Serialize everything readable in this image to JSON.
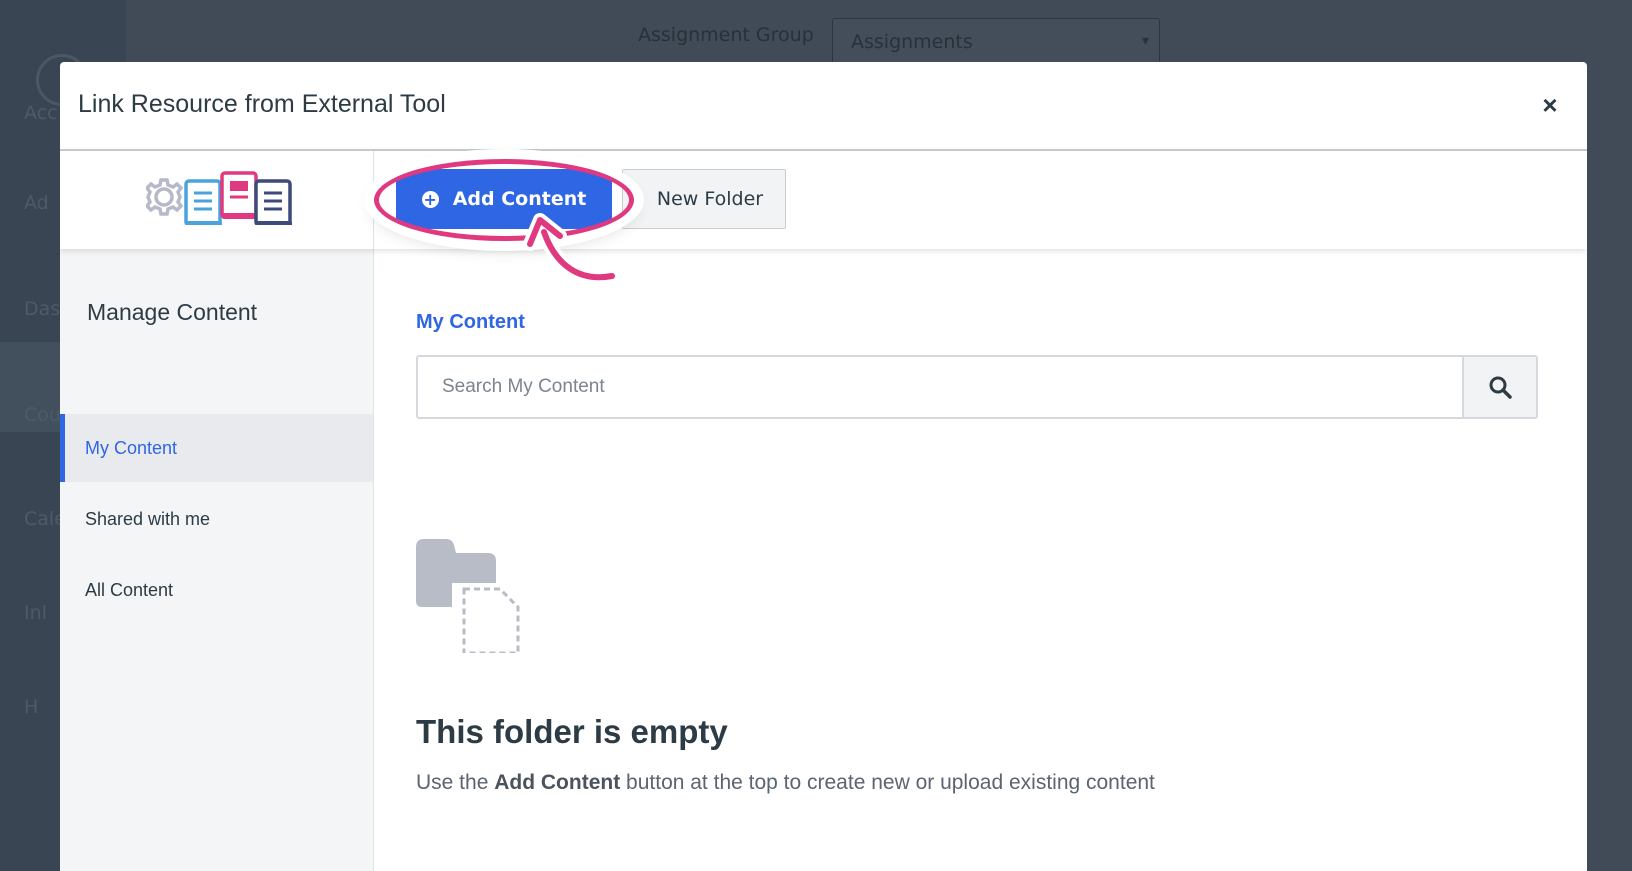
{
  "background": {
    "assignment_group_label": "Assignment Group",
    "assignment_group_value": "Assignments",
    "nav_labels": [
      "Acc",
      "Ad",
      "Dash",
      "Cou",
      "Cale",
      "Inl",
      "H"
    ]
  },
  "modal": {
    "title": "Link Resource from External Tool",
    "close_label": "×"
  },
  "toolbar": {
    "add_content_label": "Add Content",
    "new_folder_label": "New Folder"
  },
  "sidebar": {
    "title": "Manage Content",
    "items": [
      {
        "label": "My Content",
        "active": true
      },
      {
        "label": "Shared with me",
        "active": false
      },
      {
        "label": "All Content",
        "active": false
      }
    ]
  },
  "main": {
    "section_title": "My Content",
    "search_placeholder": "Search My Content",
    "empty_title": "This folder is empty",
    "empty_text_before": "Use the ",
    "empty_text_bold": "Add Content",
    "empty_text_after": " button at the top to create new or upload existing content"
  },
  "colors": {
    "accent": "#2f66e4",
    "highlight": "#e0397f"
  }
}
